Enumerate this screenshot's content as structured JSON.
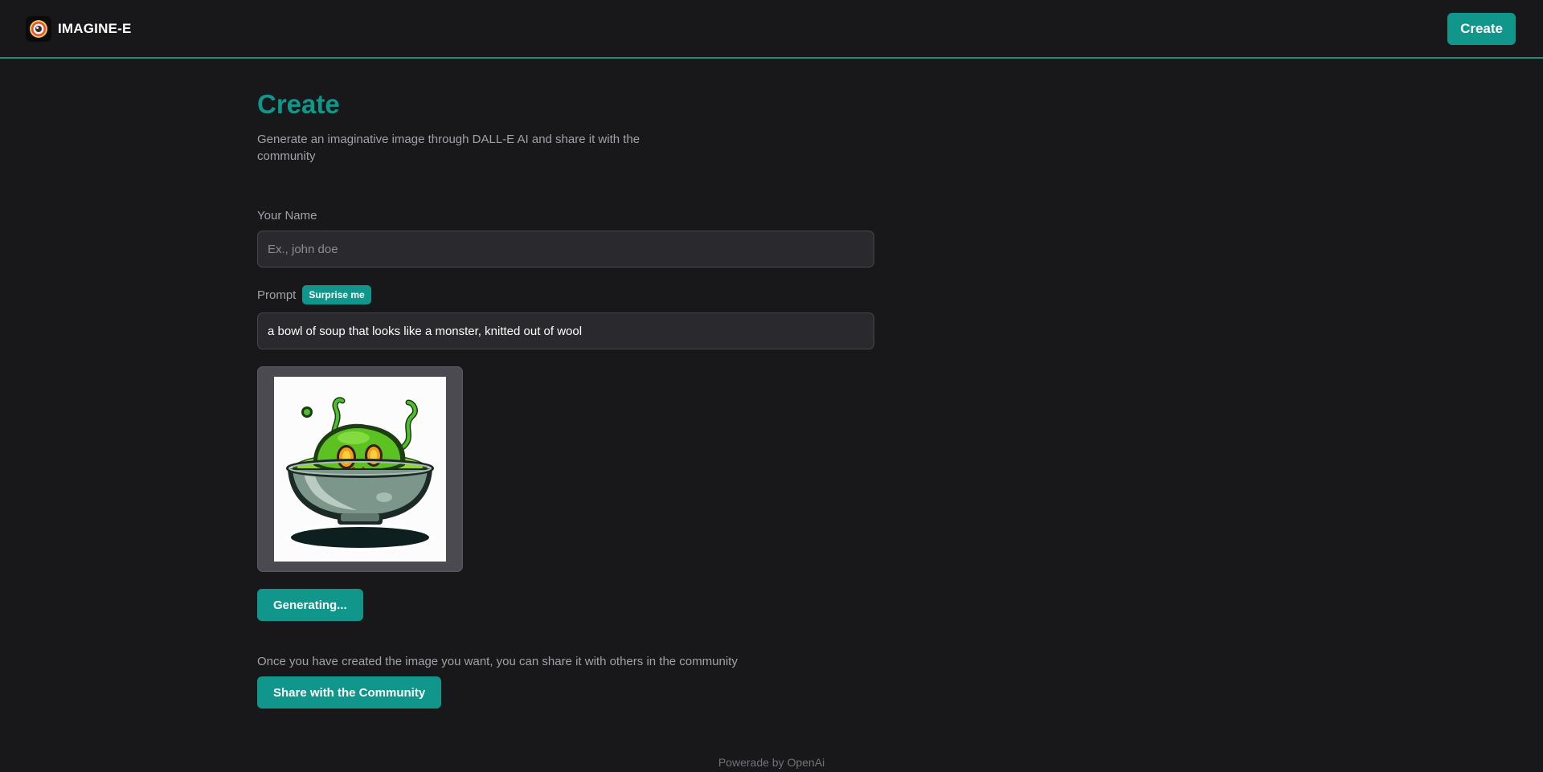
{
  "header": {
    "brand": "IMAGINE-E",
    "create_label": "Create"
  },
  "page": {
    "title": "Create",
    "subtitle": "Generate an imaginative image through DALL-E AI and share it with the community"
  },
  "form": {
    "name_label": "Your Name",
    "name_placeholder": "Ex., john doe",
    "name_value": "",
    "prompt_label": "Prompt",
    "surprise_label": "Surprise me",
    "prompt_value": "a bowl of soup that looks like a monster, knitted out of wool"
  },
  "actions": {
    "generate_label": "Generating...",
    "share_note": "Once you have created the image you want, you can share it with others in the community",
    "share_label": "Share with the Community"
  },
  "footer": {
    "text": "Powerade by OpenAi"
  },
  "colors": {
    "accent": "#10968a",
    "background": "#18181b",
    "input_bg": "#2a2a2e"
  },
  "icons": {
    "logo": "imagine-logo-icon"
  }
}
